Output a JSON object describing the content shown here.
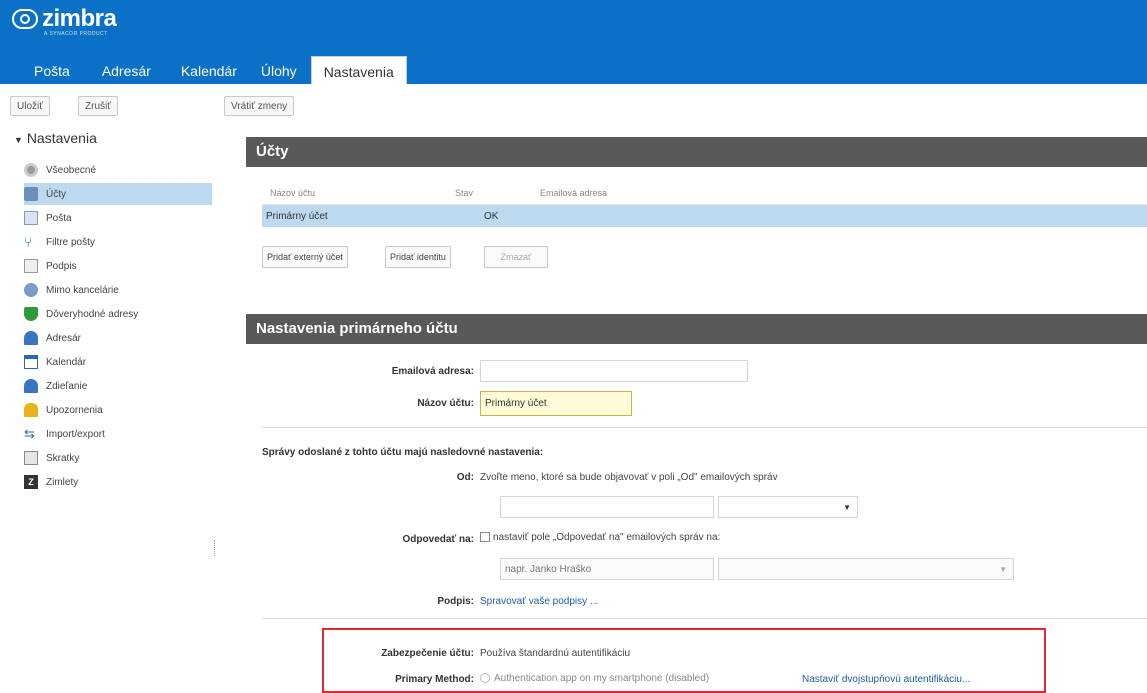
{
  "app": {
    "logo_text": "zimbra",
    "logo_sub": "A SYNACOR PRODUCT"
  },
  "tabs": [
    {
      "label": "Pošta"
    },
    {
      "label": "Adresár"
    },
    {
      "label": "Kalendár"
    },
    {
      "label": "Úlohy"
    },
    {
      "label": "Nastavenia"
    }
  ],
  "toolbar": {
    "save": "Uložiť",
    "cancel": "Zrušiť",
    "revert": "Vrátiť zmeny"
  },
  "sidebar": {
    "title": "Nastavenia",
    "items": [
      {
        "label": "Všeobecné",
        "icon": "gear-icon"
      },
      {
        "label": "Účty",
        "icon": "accounts-icon"
      },
      {
        "label": "Pošta",
        "icon": "mail-icon"
      },
      {
        "label": "Filtre pošty",
        "icon": "filter-icon"
      },
      {
        "label": "Podpis",
        "icon": "signature-icon"
      },
      {
        "label": "Mimo kancelárie",
        "icon": "out-of-office-icon"
      },
      {
        "label": "Dôveryhodné adresy",
        "icon": "shield-icon"
      },
      {
        "label": "Adresár",
        "icon": "contacts-icon"
      },
      {
        "label": "Kalendár",
        "icon": "calendar-icon"
      },
      {
        "label": "Zdieľanie",
        "icon": "sharing-icon"
      },
      {
        "label": "Upozornenia",
        "icon": "bell-icon"
      },
      {
        "label": "Import/export",
        "icon": "import-export-icon"
      },
      {
        "label": "Skratky",
        "icon": "keyboard-icon"
      },
      {
        "label": "Zimlety",
        "icon": "zimlet-icon"
      }
    ]
  },
  "accounts": {
    "title": "Účty",
    "columns": [
      "Názov účtu",
      "Stav",
      "Emailová adresa"
    ],
    "rows": [
      {
        "name": "Primárny účet",
        "status": "OK",
        "email": ""
      }
    ],
    "add_external": "Pridať externý účet",
    "add_identity": "Pridať identitu",
    "delete": "Zmazať"
  },
  "primary": {
    "title": "Nastavenia primárneho účtu",
    "email_label": "Emailová adresa:",
    "email_value": "",
    "name_label": "Názov účtu:",
    "name_value": "Primárny účet",
    "sent_heading": "Správy odoslané z tohto účtu majú nasledovné nastavenia:",
    "from_label": "Od:",
    "from_desc": "Zvoľte meno, ktoré sa bude objavovať v poli „Od\" emailových správ",
    "reply_label": "Odpovedať na:",
    "reply_desc": "nastaviť pole „Odpovedať na\" emailových správ na:",
    "reply_placeholder": "napr. Janko Hraško",
    "signature_label": "Podpis:",
    "signature_link": "Spravovať vaše podpisy ...",
    "security_label": "Zabezpečenie účtu:",
    "security_value": "Používa štandardnú autentifikáciu",
    "method_label": "Primary Method:",
    "method_value": "Authentication app on my smartphone (disabled)",
    "twofa_link": "Nastaviť dvojstupňovú autentifikáciu..."
  },
  "colors": {
    "brand": "#0b71c6",
    "section": "#595959",
    "selection": "#bcd9f0",
    "highlight": "#e0262e"
  }
}
